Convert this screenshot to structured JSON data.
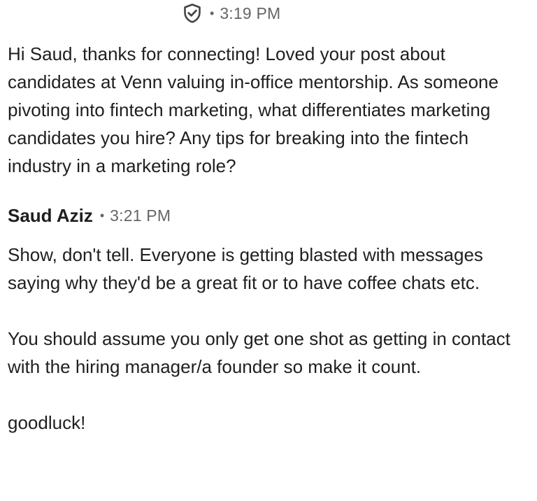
{
  "messages": [
    {
      "header": {
        "icon": "shield-check-icon",
        "separator": "•",
        "time": "3:19 PM"
      },
      "paragraphs": [
        "Hi Saud, thanks for connecting! Loved your post about candidates at Venn valuing in-office mentorship. As someone pivoting into fintech marketing, what differentiates marketing candidates you hire? Any tips for breaking into the fintech industry in a marketing role?"
      ]
    },
    {
      "header": {
        "sender": "Saud Aziz",
        "separator": "•",
        "time": "3:21 PM"
      },
      "paragraphs": [
        "Show, don't tell. Everyone is getting blasted with messages saying why they'd be a great fit or to have coffee chats etc.",
        "You should assume you only get one shot as getting in contact with the hiring manager/a founder so make it count.",
        "goodluck!"
      ]
    }
  ],
  "colors": {
    "text": "#1f1f1f",
    "meta": "#666666",
    "icon": "#444444"
  }
}
